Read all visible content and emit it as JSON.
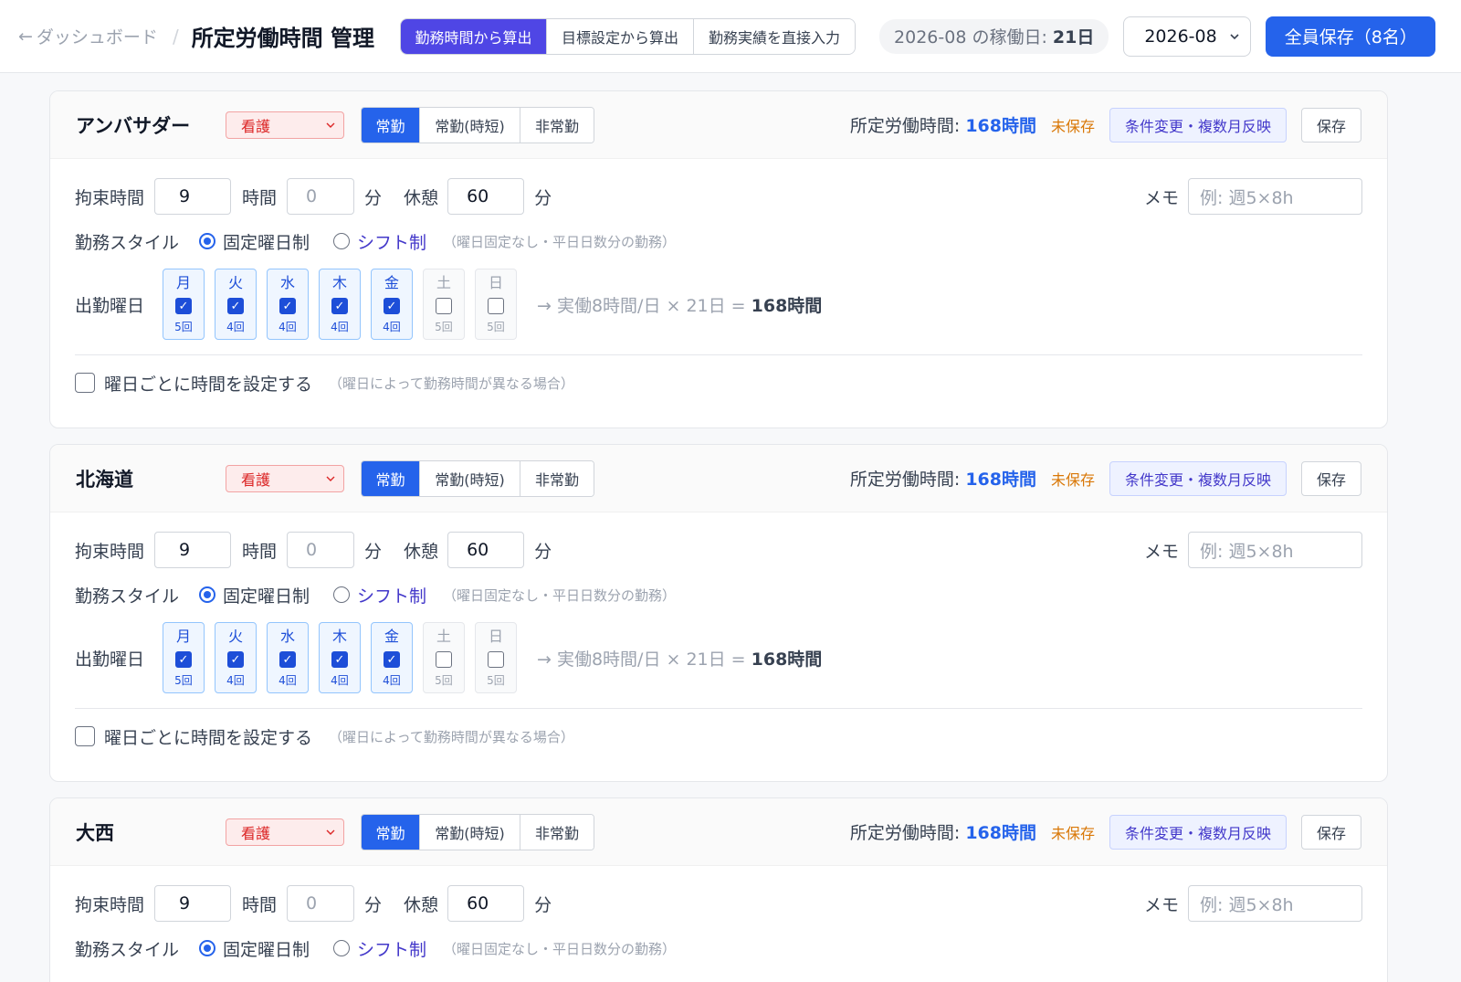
{
  "header": {
    "back_label": "ダッシュボード",
    "separator": "/",
    "title": "所定労働時間 管理",
    "modes": [
      "勤務時間から算出",
      "目標設定から算出",
      "勤務実績を直接入力"
    ],
    "workdays_label": "2026-08 の稼働日:",
    "workdays_value": "21日",
    "month_value": "2026-08",
    "save_all_label": "全員保存（8名）"
  },
  "labels": {
    "binding_time": "拘束時間",
    "hours_unit": "時間",
    "minutes_unit": "分",
    "break": "休憩",
    "memo": "メモ",
    "work_style": "勤務スタイル",
    "fixed_days": "固定曜日制",
    "shift": "シフト制",
    "shift_note": "（曜日固定なし・平日日数分の勤務）",
    "workdays": "出勤曜日",
    "per_day": "曜日ごとに時間を設定する",
    "per_day_note": "（曜日によって勤務時間が異なる場合）",
    "total_label": "所定労働時間:",
    "unsaved": "未保存",
    "multi_month": "条件変更・複数月反映",
    "save": "保存",
    "types": [
      "常勤",
      "常勤(時短)",
      "非常勤"
    ]
  },
  "staff": [
    {
      "name": "アンバサダー",
      "role": "看護",
      "total": "168時間",
      "binding_hours": "9",
      "binding_minutes": "0",
      "break_minutes": "60",
      "memo_placeholder": "例: 週5×8h",
      "calc_text": "→ 実働8時間/日 × 21日 =",
      "calc_result": "168時間",
      "days": [
        {
          "label": "月",
          "count": "5回",
          "checked": true
        },
        {
          "label": "火",
          "count": "4回",
          "checked": true
        },
        {
          "label": "水",
          "count": "4回",
          "checked": true
        },
        {
          "label": "木",
          "count": "4回",
          "checked": true
        },
        {
          "label": "金",
          "count": "4回",
          "checked": true
        },
        {
          "label": "土",
          "count": "5回",
          "checked": false
        },
        {
          "label": "日",
          "count": "5回",
          "checked": false
        }
      ]
    },
    {
      "name": "北海道",
      "role": "看護",
      "total": "168時間",
      "binding_hours": "9",
      "binding_minutes": "0",
      "break_minutes": "60",
      "memo_placeholder": "例: 週5×8h",
      "calc_text": "→ 実働8時間/日 × 21日 =",
      "calc_result": "168時間",
      "days": [
        {
          "label": "月",
          "count": "5回",
          "checked": true
        },
        {
          "label": "火",
          "count": "4回",
          "checked": true
        },
        {
          "label": "水",
          "count": "4回",
          "checked": true
        },
        {
          "label": "木",
          "count": "4回",
          "checked": true
        },
        {
          "label": "金",
          "count": "4回",
          "checked": true
        },
        {
          "label": "土",
          "count": "5回",
          "checked": false
        },
        {
          "label": "日",
          "count": "5回",
          "checked": false
        }
      ]
    },
    {
      "name": "大西",
      "role": "看護",
      "total": "168時間",
      "binding_hours": "9",
      "binding_minutes": "0",
      "break_minutes": "60",
      "memo_placeholder": "例: 週5×8h",
      "calc_text": "",
      "calc_result": "",
      "days": []
    }
  ],
  "colors": {
    "primary": "#2563eb",
    "mode_active": "#4f46e5",
    "unsaved": "#d97706",
    "role_badge": "#dc2626"
  }
}
